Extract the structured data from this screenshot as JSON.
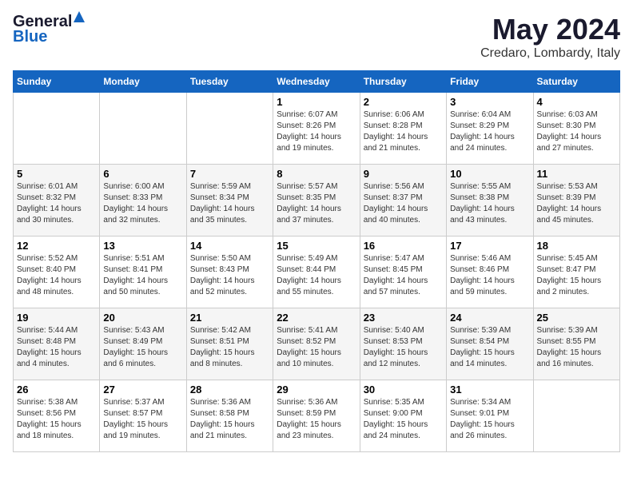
{
  "logo": {
    "general": "General",
    "blue": "Blue"
  },
  "title": "May 2024",
  "subtitle": "Credaro, Lombardy, Italy",
  "days_of_week": [
    "Sunday",
    "Monday",
    "Tuesday",
    "Wednesday",
    "Thursday",
    "Friday",
    "Saturday"
  ],
  "weeks": [
    [
      {
        "day": "",
        "info": ""
      },
      {
        "day": "",
        "info": ""
      },
      {
        "day": "",
        "info": ""
      },
      {
        "day": "1",
        "info": "Sunrise: 6:07 AM\nSunset: 8:26 PM\nDaylight: 14 hours\nand 19 minutes."
      },
      {
        "day": "2",
        "info": "Sunrise: 6:06 AM\nSunset: 8:28 PM\nDaylight: 14 hours\nand 21 minutes."
      },
      {
        "day": "3",
        "info": "Sunrise: 6:04 AM\nSunset: 8:29 PM\nDaylight: 14 hours\nand 24 minutes."
      },
      {
        "day": "4",
        "info": "Sunrise: 6:03 AM\nSunset: 8:30 PM\nDaylight: 14 hours\nand 27 minutes."
      }
    ],
    [
      {
        "day": "5",
        "info": "Sunrise: 6:01 AM\nSunset: 8:32 PM\nDaylight: 14 hours\nand 30 minutes."
      },
      {
        "day": "6",
        "info": "Sunrise: 6:00 AM\nSunset: 8:33 PM\nDaylight: 14 hours\nand 32 minutes."
      },
      {
        "day": "7",
        "info": "Sunrise: 5:59 AM\nSunset: 8:34 PM\nDaylight: 14 hours\nand 35 minutes."
      },
      {
        "day": "8",
        "info": "Sunrise: 5:57 AM\nSunset: 8:35 PM\nDaylight: 14 hours\nand 37 minutes."
      },
      {
        "day": "9",
        "info": "Sunrise: 5:56 AM\nSunset: 8:37 PM\nDaylight: 14 hours\nand 40 minutes."
      },
      {
        "day": "10",
        "info": "Sunrise: 5:55 AM\nSunset: 8:38 PM\nDaylight: 14 hours\nand 43 minutes."
      },
      {
        "day": "11",
        "info": "Sunrise: 5:53 AM\nSunset: 8:39 PM\nDaylight: 14 hours\nand 45 minutes."
      }
    ],
    [
      {
        "day": "12",
        "info": "Sunrise: 5:52 AM\nSunset: 8:40 PM\nDaylight: 14 hours\nand 48 minutes."
      },
      {
        "day": "13",
        "info": "Sunrise: 5:51 AM\nSunset: 8:41 PM\nDaylight: 14 hours\nand 50 minutes."
      },
      {
        "day": "14",
        "info": "Sunrise: 5:50 AM\nSunset: 8:43 PM\nDaylight: 14 hours\nand 52 minutes."
      },
      {
        "day": "15",
        "info": "Sunrise: 5:49 AM\nSunset: 8:44 PM\nDaylight: 14 hours\nand 55 minutes."
      },
      {
        "day": "16",
        "info": "Sunrise: 5:47 AM\nSunset: 8:45 PM\nDaylight: 14 hours\nand 57 minutes."
      },
      {
        "day": "17",
        "info": "Sunrise: 5:46 AM\nSunset: 8:46 PM\nDaylight: 14 hours\nand 59 minutes."
      },
      {
        "day": "18",
        "info": "Sunrise: 5:45 AM\nSunset: 8:47 PM\nDaylight: 15 hours\nand 2 minutes."
      }
    ],
    [
      {
        "day": "19",
        "info": "Sunrise: 5:44 AM\nSunset: 8:48 PM\nDaylight: 15 hours\nand 4 minutes."
      },
      {
        "day": "20",
        "info": "Sunrise: 5:43 AM\nSunset: 8:49 PM\nDaylight: 15 hours\nand 6 minutes."
      },
      {
        "day": "21",
        "info": "Sunrise: 5:42 AM\nSunset: 8:51 PM\nDaylight: 15 hours\nand 8 minutes."
      },
      {
        "day": "22",
        "info": "Sunrise: 5:41 AM\nSunset: 8:52 PM\nDaylight: 15 hours\nand 10 minutes."
      },
      {
        "day": "23",
        "info": "Sunrise: 5:40 AM\nSunset: 8:53 PM\nDaylight: 15 hours\nand 12 minutes."
      },
      {
        "day": "24",
        "info": "Sunrise: 5:39 AM\nSunset: 8:54 PM\nDaylight: 15 hours\nand 14 minutes."
      },
      {
        "day": "25",
        "info": "Sunrise: 5:39 AM\nSunset: 8:55 PM\nDaylight: 15 hours\nand 16 minutes."
      }
    ],
    [
      {
        "day": "26",
        "info": "Sunrise: 5:38 AM\nSunset: 8:56 PM\nDaylight: 15 hours\nand 18 minutes."
      },
      {
        "day": "27",
        "info": "Sunrise: 5:37 AM\nSunset: 8:57 PM\nDaylight: 15 hours\nand 19 minutes."
      },
      {
        "day": "28",
        "info": "Sunrise: 5:36 AM\nSunset: 8:58 PM\nDaylight: 15 hours\nand 21 minutes."
      },
      {
        "day": "29",
        "info": "Sunrise: 5:36 AM\nSunset: 8:59 PM\nDaylight: 15 hours\nand 23 minutes."
      },
      {
        "day": "30",
        "info": "Sunrise: 5:35 AM\nSunset: 9:00 PM\nDaylight: 15 hours\nand 24 minutes."
      },
      {
        "day": "31",
        "info": "Sunrise: 5:34 AM\nSunset: 9:01 PM\nDaylight: 15 hours\nand 26 minutes."
      },
      {
        "day": "",
        "info": ""
      }
    ]
  ]
}
